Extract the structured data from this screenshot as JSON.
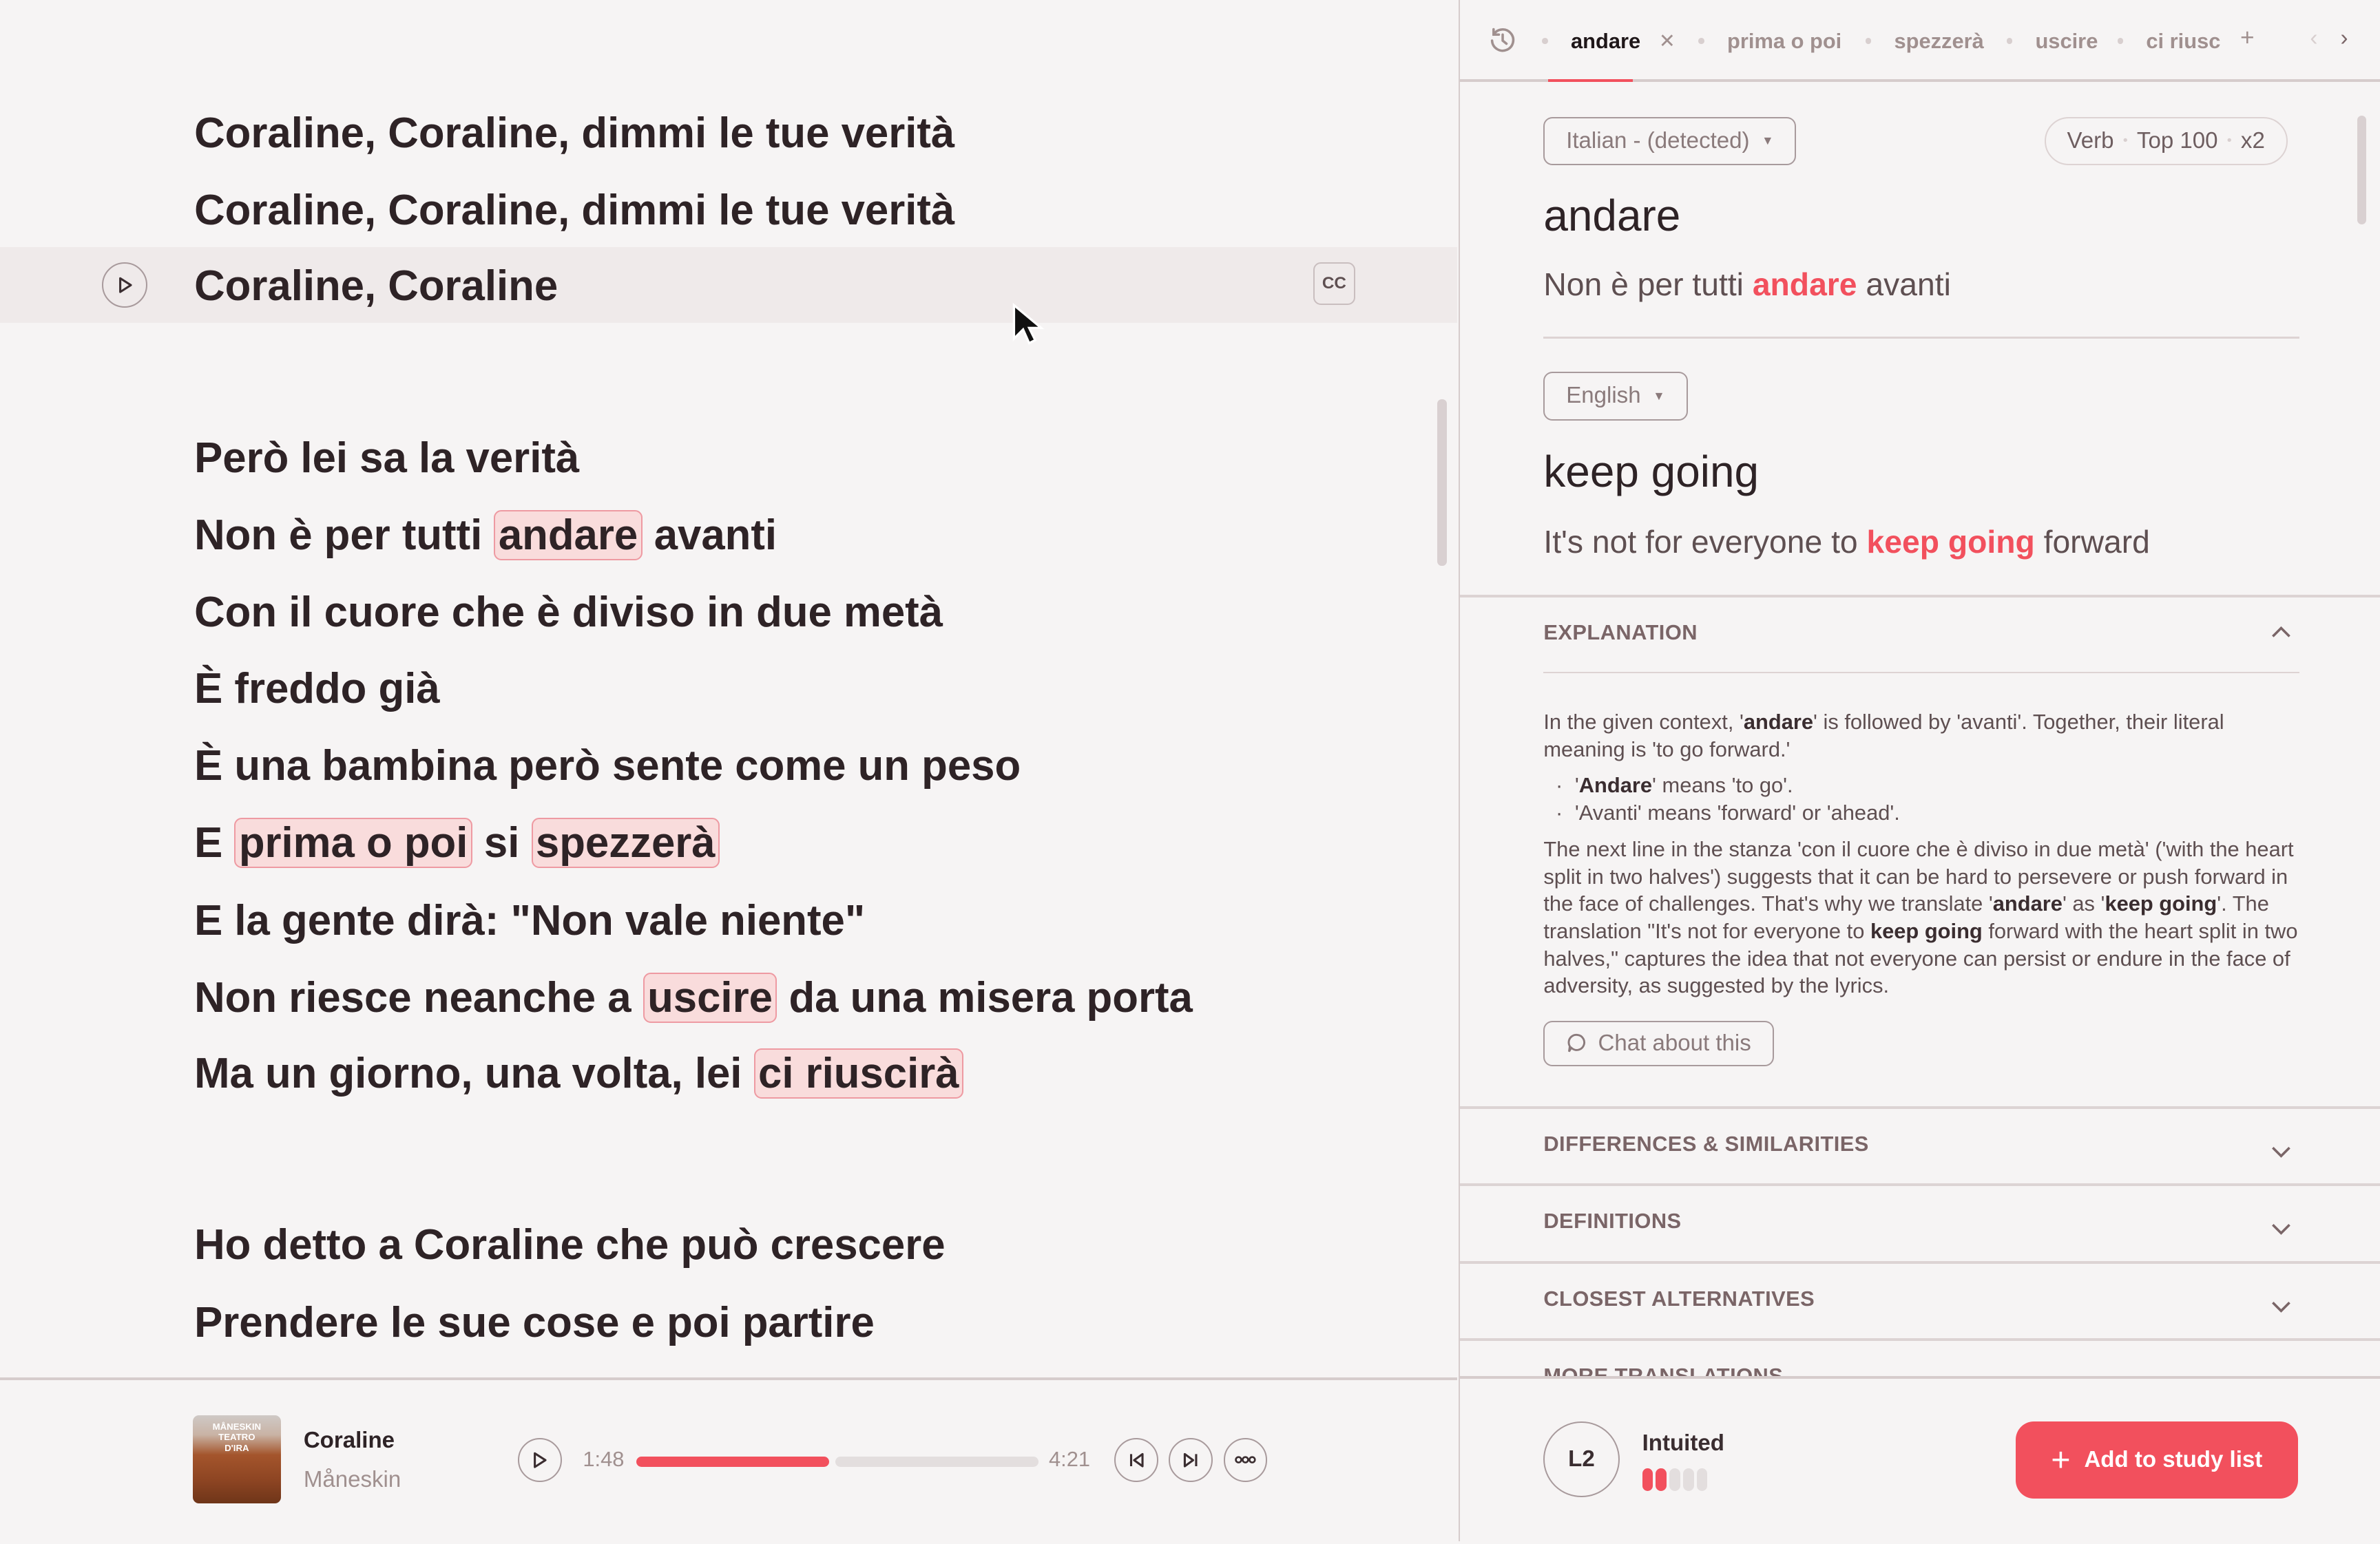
{
  "lyrics": {
    "lines": [
      {
        "segments": [
          {
            "text": "Coraline, Coraline, dimmi le tue verità"
          }
        ]
      },
      {
        "segments": [
          {
            "text": "Coraline, Coraline, dimmi le tue verità"
          }
        ]
      },
      {
        "segments": [
          {
            "text": "Coraline, Coraline"
          }
        ],
        "active": true
      },
      {
        "segments": [
          {
            "text": "Però lei sa la verità"
          }
        ]
      },
      {
        "segments": [
          {
            "text": "Non è per tutti "
          },
          {
            "text": "andare",
            "highlight": true
          },
          {
            "text": " avanti"
          }
        ]
      },
      {
        "segments": [
          {
            "text": "Con il cuore che è diviso in due metà"
          }
        ]
      },
      {
        "segments": [
          {
            "text": "È freddo già"
          }
        ]
      },
      {
        "segments": [
          {
            "text": "È una bambina però sente come un peso"
          }
        ]
      },
      {
        "segments": [
          {
            "text": "E "
          },
          {
            "text": "prima o poi",
            "highlight": true
          },
          {
            "text": " si "
          },
          {
            "text": "spezzerà",
            "highlight": true
          }
        ]
      },
      {
        "segments": [
          {
            "text": "E la gente dirà: \"Non vale niente\""
          }
        ]
      },
      {
        "segments": [
          {
            "text": "Non riesce neanche a "
          },
          {
            "text": "uscire",
            "highlight": true
          },
          {
            "text": " da una misera porta"
          }
        ]
      },
      {
        "segments": [
          {
            "text": "Ma un giorno, una volta, lei "
          },
          {
            "text": "ci riuscirà",
            "highlight": true
          }
        ]
      },
      {
        "segments": [
          {
            "text": "Ho detto a Coraline che può crescere"
          }
        ]
      },
      {
        "segments": [
          {
            "text": "Prendere le sue cose e poi partire"
          }
        ]
      }
    ],
    "cc_label": "CC"
  },
  "player": {
    "track_title": "Coraline",
    "artist": "Måneskin",
    "album_art_text": "MÅNESKIN TEATRO D'IRA",
    "elapsed": "1:48",
    "duration": "4:21",
    "progress_fraction": 0.48
  },
  "tabs": {
    "items": [
      {
        "label": "andare",
        "active": true
      },
      {
        "label": "prima o poi"
      },
      {
        "label": "spezzerà"
      },
      {
        "label": "uscire"
      },
      {
        "label": "ci riusc"
      }
    ]
  },
  "word": {
    "source_language": "Italian - (detected)",
    "tags": [
      "Verb",
      "Top 100",
      "x2"
    ],
    "term": "andare",
    "example": [
      {
        "text": "Non è per tutti "
      },
      {
        "text": "andare",
        "accent": true
      },
      {
        "text": " avanti"
      }
    ],
    "target_language": "English",
    "translation": "keep going",
    "translated_example": [
      {
        "text": "It's not for everyone to "
      },
      {
        "text": "keep going",
        "accent": true
      },
      {
        "text": " forward"
      }
    ]
  },
  "explanation": {
    "title": "EXPLANATION",
    "para1": [
      {
        "text": "In the given context, '"
      },
      {
        "text": "andare",
        "bold": true
      },
      {
        "text": "' is followed by 'avanti'. Together, their literal meaning is 'to go forward.'"
      }
    ],
    "bullets": [
      [
        {
          "text": "'"
        },
        {
          "text": "Andare",
          "bold": true
        },
        {
          "text": "' means 'to go'."
        }
      ],
      [
        {
          "text": "'Avanti' means 'forward' or 'ahead'."
        }
      ]
    ],
    "para2": [
      {
        "text": "The next line in the stanza 'con il cuore che è diviso in due metà' ('with the heart split in two halves') suggests that it can be hard to persevere or push forward in the face of challenges. That's why we translate '"
      },
      {
        "text": "andare",
        "bold": true
      },
      {
        "text": "' as '"
      },
      {
        "text": "keep going",
        "bold": true
      },
      {
        "text": "'. The translation \"It's not for everyone to "
      },
      {
        "text": "keep going",
        "bold": true
      },
      {
        "text": " forward with the heart split in two halves,\" captures the idea that not everyone can persist or endure in the face of adversity, as suggested by the lyrics."
      }
    ],
    "chat_label": "Chat about this"
  },
  "sections": [
    "DIFFERENCES & SIMILARITIES",
    "DEFINITIONS",
    "CLOSEST ALTERNATIVES",
    "MORE TRANSLATIONS"
  ],
  "footer": {
    "level": "L2",
    "level_name": "Intuited",
    "level_progress": 2,
    "level_max": 5,
    "add_label": "Add to study list"
  },
  "colors": {
    "accent": "#f2505d",
    "highlight_fill": "#f9dcdc",
    "text": "#2e2326"
  }
}
